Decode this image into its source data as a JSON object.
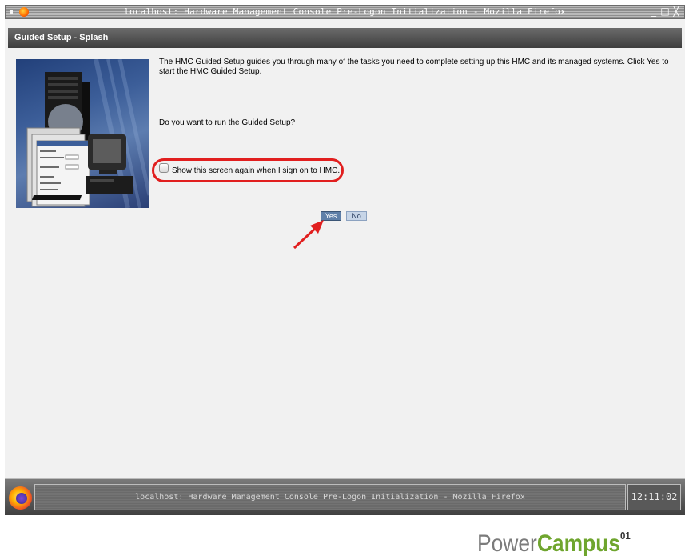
{
  "titlebar": {
    "title": "localhost: Hardware Management Console Pre-Logon Initialization - Mozilla Firefox",
    "buttons": [
      "minimize",
      "maximize",
      "close"
    ]
  },
  "page": {
    "header": "Guided Setup - Splash",
    "intro": "The HMC Guided Setup guides you through many of the tasks you need to complete setting up this HMC and its managed systems. Click Yes to start the HMC Guided Setup.",
    "question": "Do you want to run the Guided Setup?",
    "checkbox": {
      "label": "Show this screen again when I sign on to HMC.",
      "checked": false
    },
    "buttons": {
      "yes": "Yes",
      "no": "No"
    }
  },
  "taskbar": {
    "item": "localhost: Hardware Management Console Pre-Logon Initialization - Mozilla Firefox",
    "clock": "12:11:02"
  },
  "watermark": {
    "power": "Power",
    "campus": "Campus",
    "number": "01"
  },
  "colors": {
    "annotation": "#e11f1f",
    "yes_button": "#5e7fa8",
    "brand_green": "#6fa52e"
  }
}
